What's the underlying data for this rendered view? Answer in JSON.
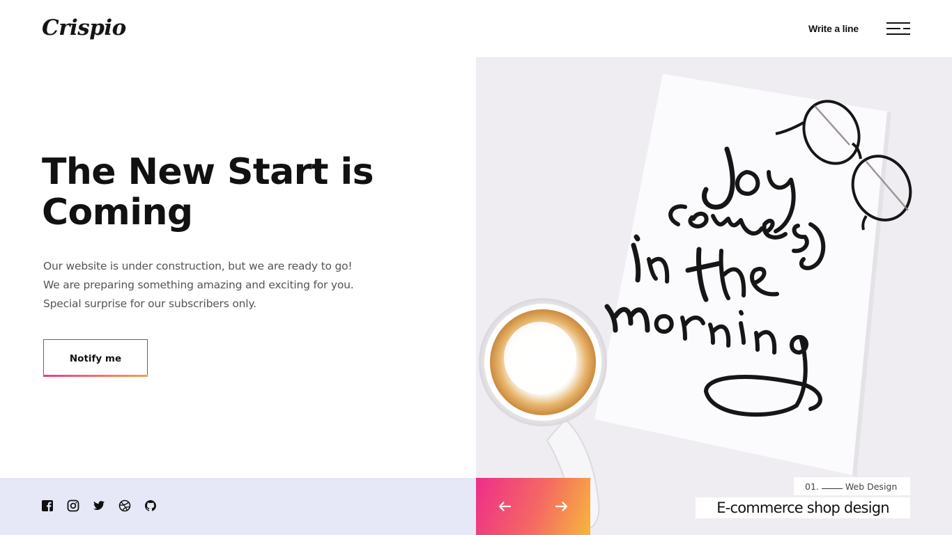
{
  "brand": {
    "logo_text": "Crispio"
  },
  "header": {
    "write_link": "Write a line",
    "menu_icon": "hamburger-menu-icon"
  },
  "hero": {
    "title": "The New Start is Coming",
    "paragraph_lines": [
      "Our website is under construction, but we are ready to go!",
      "We are preparing something amazing and exciting for you.",
      "Special surprise for our subscribers only."
    ],
    "notify_button": "Notify me"
  },
  "socials": [
    {
      "icon": "facebook-icon"
    },
    {
      "icon": "instagram-icon"
    },
    {
      "icon": "twitter-icon"
    },
    {
      "icon": "dribbble-icon"
    },
    {
      "icon": "github-icon"
    }
  ],
  "slider": {
    "prev_icon": "arrow-left-icon",
    "next_icon": "arrow-right-icon",
    "slide_number": "01.",
    "slide_category": "Web Design",
    "slide_title": "E-commerce shop design",
    "photo_handwriting": [
      "joy",
      "comes",
      "in the",
      "morning"
    ]
  },
  "colors": {
    "accent_gradient_start": "#ee2d8a",
    "accent_gradient_end": "#f6b73c",
    "footer_strip": "#e6e8f7",
    "text_dark": "#111111",
    "text_body": "#555555"
  }
}
